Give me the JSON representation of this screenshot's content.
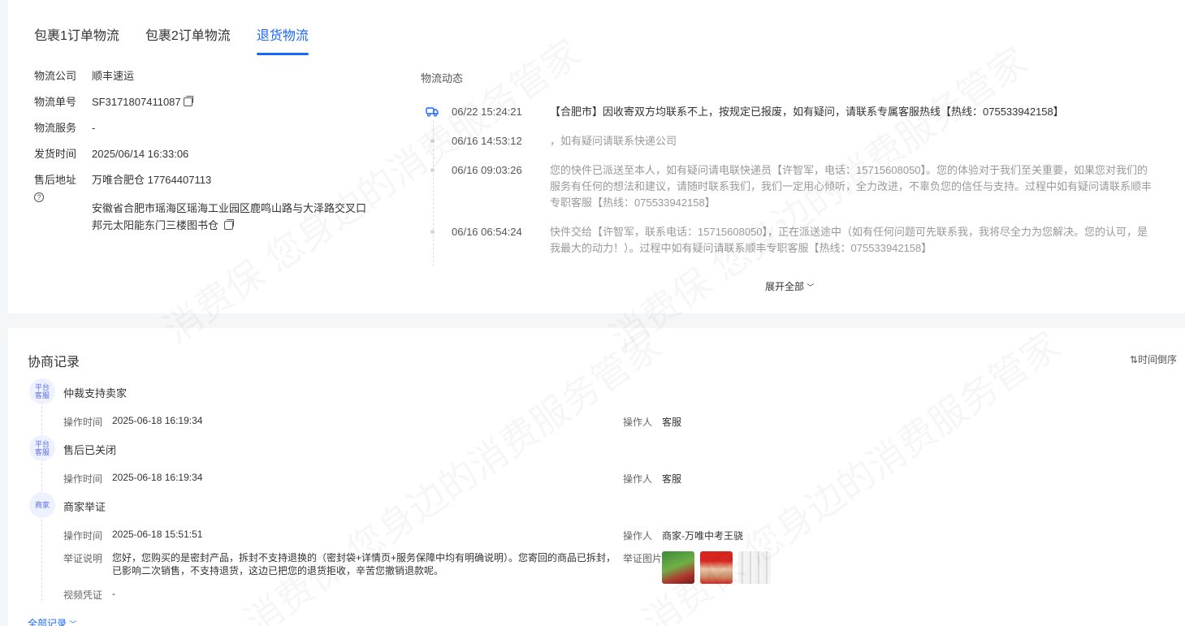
{
  "tabs": [
    "包裹1订单物流",
    "包裹2订单物流",
    "退货物流"
  ],
  "info": {
    "company_label": "物流公司",
    "company": "顺丰速运",
    "number_label": "物流单号",
    "number": "SF3171807411087",
    "service_label": "物流服务",
    "service": "-",
    "ship_time_label": "发货时间",
    "ship_time": "2025/06/14 16:33:06",
    "address_label": "售后地址",
    "address_contact": "万唯合肥仓 17764407113",
    "address_line1": "安徽省合肥市瑶海区瑶海工业园区鹿鸣山路与大泽路交叉口",
    "address_line2": "邦元太阳能东门三楼图书仓"
  },
  "logistics": {
    "title": "物流动态",
    "events": [
      {
        "time": "06/22 15:24:21",
        "text": "【合肥市】因收寄双方均联系不上，按规定已报废，如有疑问，请联系专属客服热线【热线：075533942158】"
      },
      {
        "time": "06/16 14:53:12",
        "text": "，如有疑问请联系快递公司"
      },
      {
        "time": "06/16 09:03:26",
        "text": "您的快件已派送至本人，如有疑问请电联快递员【许智军，电话：15715608050】。您的体验对于我们至关重要，如果您对我们的服务有任何的想法和建议，请随时联系我们，我们一定用心倾听，全力改进，不辜负您的信任与支持。过程中如有疑问请联系顺丰专职客服【热线：075533942158】"
      },
      {
        "time": "06/16 06:54:24",
        "text": "快件交给【许智军，联系电话：15715608050】，正在派送途中（如有任何问题可先联系我，我将尽全力为您解决。您的认可，是我最大的动力！）。过程中如有疑问请联系顺丰专职客服【热线：075533942158】"
      }
    ],
    "expand": "展开全部"
  },
  "negotiation": {
    "title": "协商记录",
    "sort": "时间倒序",
    "op_time_label": "操作时间",
    "operator_label": "操作人",
    "records": [
      {
        "badge_line1": "平台",
        "badge_line2": "客服",
        "title": "仲裁支持卖家",
        "time": "2025-06-18 16:19:34",
        "operator": "客服"
      },
      {
        "badge_line1": "平台",
        "badge_line2": "客服",
        "title": "售后已关闭",
        "time": "2025-06-18 16:19:34",
        "operator": "客服"
      },
      {
        "badge_line1": "商家",
        "badge_line2": "",
        "title": "商家举证",
        "time": "2025-06-18 15:51:51",
        "operator": "商家-万唯中考王骁"
      }
    ],
    "evidence_label": "举证说明",
    "evidence": "您好，您购买的是密封产品，拆封不支持退换的（密封袋+详情页+服务保障中均有明确说明）。您寄回的商品已拆封，已影响二次销售，不支持退货，这边已把您的退货拒收，辛苦您撤销退款呢。",
    "images_label": "举证图片",
    "video_label": "视频凭证",
    "video": "-",
    "all_records": "全部记录"
  },
  "watermark": "消费保 您身边的消费服务管家",
  "colors": {
    "accent": "#1966ff",
    "badge_bg": "#eef1ff",
    "badge_text": "#5b6ef5"
  }
}
